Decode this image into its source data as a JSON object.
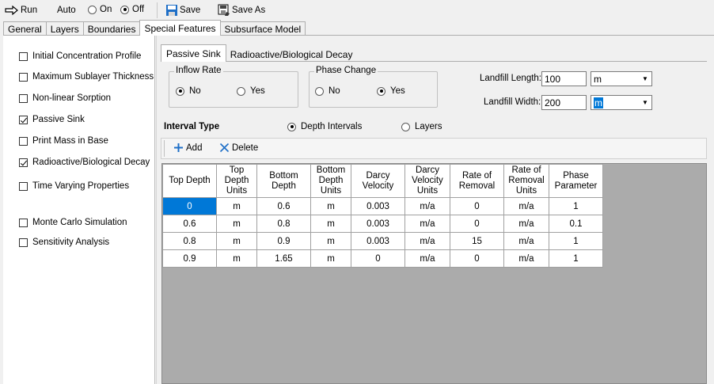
{
  "toolbar": {
    "run_label": "Run",
    "auto_label": "Auto",
    "on_label": "On",
    "off_label": "Off",
    "save_label": "Save",
    "save_as_label": "Save As"
  },
  "main_tabs": [
    "General",
    "Layers",
    "Boundaries",
    "Special Features",
    "Subsurface Model"
  ],
  "features": [
    {
      "label": "Initial Concentration Profile",
      "checked": false
    },
    {
      "label": "Maximum Sublayer Thickness",
      "checked": false
    },
    {
      "label": "Non-linear Sorption",
      "checked": false
    },
    {
      "label": "Passive Sink",
      "checked": true
    },
    {
      "label": "Print Mass in Base",
      "checked": false
    },
    {
      "label": "Radioactive/Biological Decay",
      "checked": true
    },
    {
      "label": "Time Varying Properties",
      "checked": false
    },
    {
      "label": "Monte Carlo Simulation",
      "checked": false
    },
    {
      "label": "Sensitivity Analysis",
      "checked": false
    }
  ],
  "sub_tabs": [
    "Passive Sink",
    "Radioactive/Biological Decay"
  ],
  "inflow_rate": {
    "title": "Inflow Rate",
    "no": "No",
    "yes": "Yes",
    "selected": "No"
  },
  "phase_change": {
    "title": "Phase Change",
    "no": "No",
    "yes": "Yes",
    "selected": "Yes"
  },
  "landfill": {
    "length_label": "Landfill Length:",
    "length_value": "100",
    "length_unit": "m",
    "width_label": "Landfill Width:",
    "width_value": "200",
    "width_unit": "m"
  },
  "interval_type": {
    "label": "Interval Type",
    "depth": "Depth Intervals",
    "layers": "Layers",
    "selected": "Depth Intervals"
  },
  "grid_toolbar": {
    "add_label": "Add",
    "delete_label": "Delete"
  },
  "table": {
    "headers": [
      [
        "Top Depth"
      ],
      [
        "Top",
        "Depth",
        "Units"
      ],
      [
        "Bottom",
        "Depth"
      ],
      [
        "Bottom",
        "Depth",
        "Units"
      ],
      [
        "Darcy",
        "Velocity"
      ],
      [
        "Darcy",
        "Velocity",
        "Units"
      ],
      [
        "Rate of",
        "Removal"
      ],
      [
        "Rate of",
        "Removal",
        "Units"
      ],
      [
        "Phase",
        "Parameter"
      ]
    ],
    "rows": [
      [
        "0",
        "m",
        "0.6",
        "m",
        "0.003",
        "m/a",
        "0",
        "m/a",
        "1"
      ],
      [
        "0.6",
        "m",
        "0.8",
        "m",
        "0.003",
        "m/a",
        "0",
        "m/a",
        "0.1"
      ],
      [
        "0.8",
        "m",
        "0.9",
        "m",
        "0.003",
        "m/a",
        "15",
        "m/a",
        "1"
      ],
      [
        "0.9",
        "m",
        "1.65",
        "m",
        "0",
        "m/a",
        "0",
        "m/a",
        "1"
      ]
    ]
  },
  "colors": {
    "selection": "#0078d7",
    "save_icon": "#1e6fc7"
  }
}
